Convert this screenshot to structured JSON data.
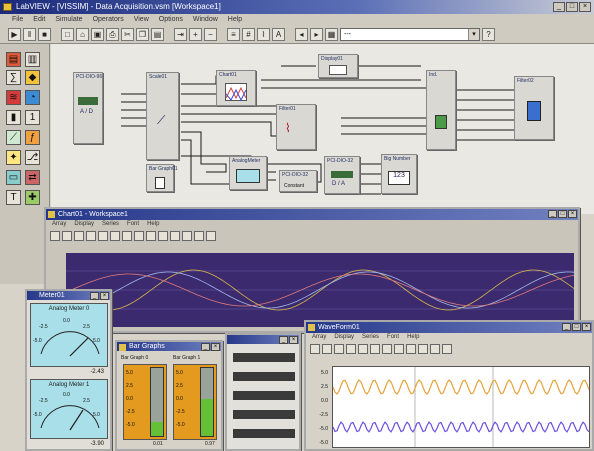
{
  "app": {
    "title": "LabVIEW - [VISSIM] - Data Acquisition.vsm [Workspace1]"
  },
  "menu": [
    "File",
    "Edit",
    "Simulate",
    "Operators",
    "View",
    "Options",
    "Window",
    "Help"
  ],
  "toolbar": {
    "combo_value": "---"
  },
  "canvas_blocks": [
    {
      "label": "PCI-DIO-96",
      "text": "A / D"
    },
    {
      "label": "Scale01",
      "text": ""
    },
    {
      "label": "Chart01",
      "text": ""
    },
    {
      "label": "Display01",
      "text": ""
    },
    {
      "label": "Filter01",
      "text": ""
    },
    {
      "label": "Ind.",
      "text": ""
    },
    {
      "label": "Bar Graph01",
      "text": ""
    },
    {
      "label": "AnalogMeter",
      "text": ""
    },
    {
      "label": "PCI-DIO-32",
      "text": "Constant"
    },
    {
      "label": "PCI-DIO-32",
      "text": "D / A"
    },
    {
      "label": "Big Number",
      "text": "123"
    },
    {
      "label": "Filter02",
      "text": ""
    }
  ],
  "strip_chart": {
    "title": "Chart01 - Workspace1",
    "menu": [
      "Array",
      "Display",
      "Series",
      "Font",
      "Help"
    ]
  },
  "analog_meters": {
    "title": "Meter01",
    "meter0": {
      "label": "Analog Meter 0",
      "scale": [
        "0.0",
        "2.5",
        "5.0",
        "-2.5",
        "-5.0"
      ],
      "value": "-2.43"
    },
    "meter1": {
      "label": "Analog Meter 1",
      "scale": [
        "0.0",
        "2.5",
        "5.0",
        "-2.5",
        "-5.0"
      ],
      "value": "-3.90"
    }
  },
  "bar_graphs": {
    "title": "Bar Graphs",
    "g0": {
      "label": "Bar Graph 0",
      "ticks": [
        "5.0",
        "2.5",
        "0.0",
        "-2.5",
        "-5.0"
      ],
      "value": "0.01",
      "level": 0.2
    },
    "g1": {
      "label": "Bar Graph 1",
      "ticks": [
        "5.0",
        "2.5",
        "0.0",
        "-2.5",
        "-5.0"
      ],
      "value": "0.97",
      "level": 0.55
    }
  },
  "waveform": {
    "title": "WaveForm01",
    "menu": [
      "Array",
      "Display",
      "Series",
      "Font",
      "Help"
    ],
    "yticks": [
      "5.0",
      "2.5",
      "0.0",
      "-2.5",
      "-5.0",
      "-5.0"
    ],
    "colors": {
      "top": "#e6a23b",
      "bottom": "#6e4fe0"
    }
  }
}
